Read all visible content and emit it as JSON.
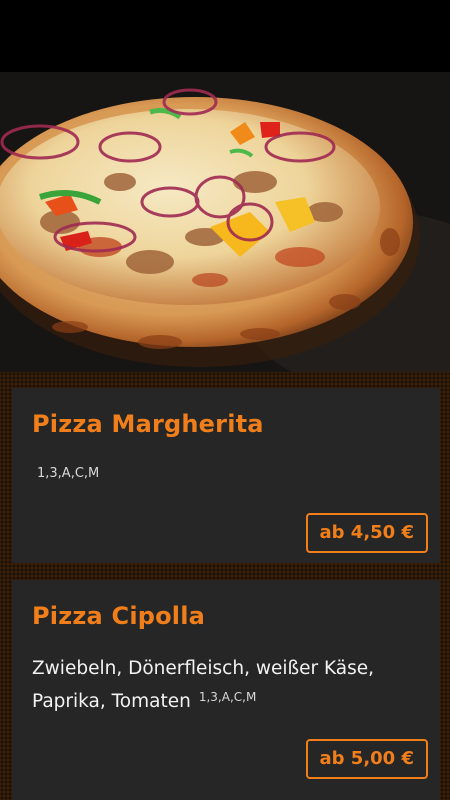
{
  "hero": {
    "image": "pizza-photo"
  },
  "menu": {
    "items": [
      {
        "name": "Pizza Margherita",
        "description": "",
        "allergens": "1,3,A,C,M",
        "price": "ab 4,50 €"
      },
      {
        "name": "Pizza Cipolla",
        "description": "Zwiebeln, Dönerfleisch, weißer Käse, Paprika, Tomaten",
        "allergens": "1,3,A,C,M",
        "price": "ab 5,00 €"
      }
    ]
  },
  "colors": {
    "accent": "#f07f1b",
    "card_bg": "#262626",
    "page_bg": "#2b1807"
  }
}
